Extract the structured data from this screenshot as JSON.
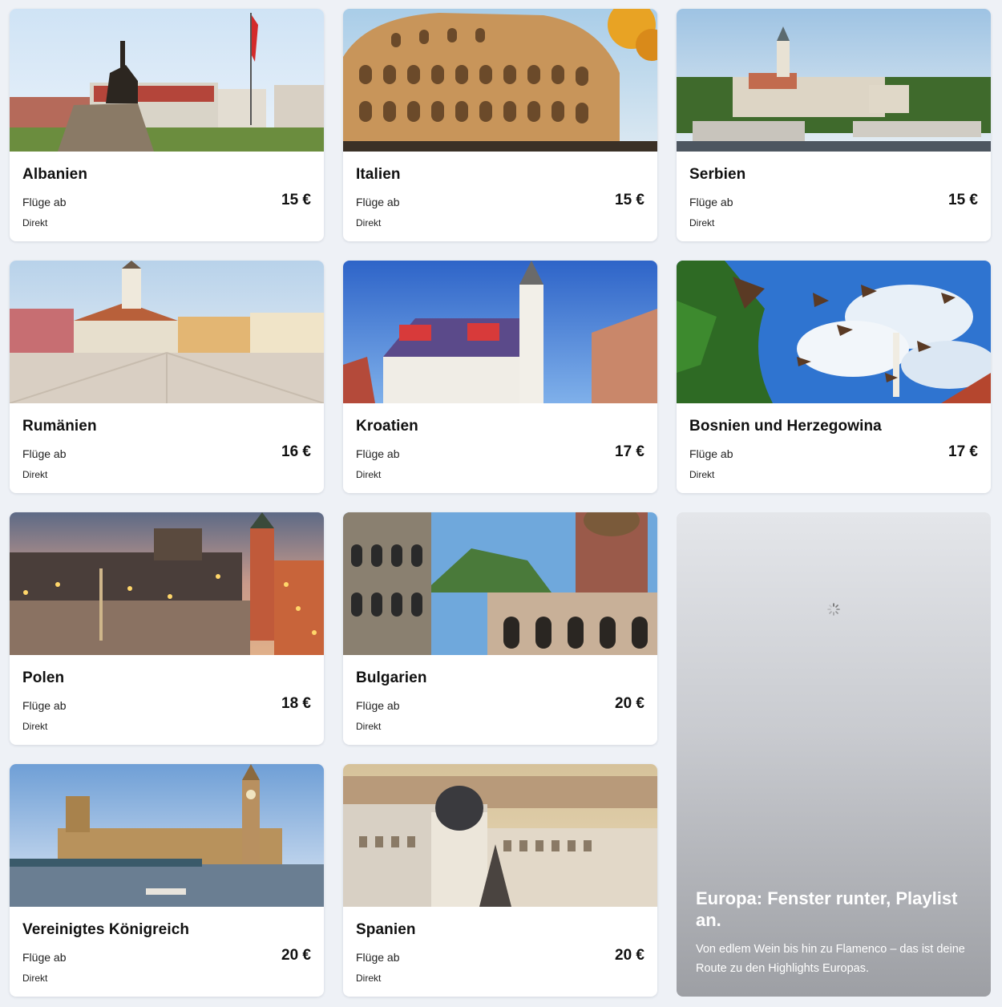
{
  "destinations": [
    {
      "name": "Albanien",
      "label": "Flüge ab",
      "price": "15 €",
      "type": "Direkt",
      "image": "albania-skanderbeg-square"
    },
    {
      "name": "Italien",
      "label": "Flüge ab",
      "price": "15 €",
      "type": "Direkt",
      "image": "rome-colosseum"
    },
    {
      "name": "Serbien",
      "label": "Flüge ab",
      "price": "15 €",
      "type": "Direkt",
      "image": "belgrade-skyline"
    },
    {
      "name": "Rumänien",
      "label": "Flüge ab",
      "price": "16 €",
      "type": "Direkt",
      "image": "brasov-council-square"
    },
    {
      "name": "Kroatien",
      "label": "Flüge ab",
      "price": "17 €",
      "type": "Direkt",
      "image": "zagreb-st-marks-church"
    },
    {
      "name": "Bosnien und Herzegowina",
      "label": "Flüge ab",
      "price": "17 €",
      "type": "Direkt",
      "image": "sarajevo-pigeons"
    },
    {
      "name": "Polen",
      "label": "Flüge ab",
      "price": "18 €",
      "type": "Direkt",
      "image": "warsaw-castle-square"
    },
    {
      "name": "Bulgarien",
      "label": "Flüge ab",
      "price": "20 €",
      "type": "Direkt",
      "image": "rila-monastery"
    },
    {
      "name": "Vereinigtes Königreich",
      "label": "Flüge ab",
      "price": "20 €",
      "type": "Direkt",
      "image": "london-westminster"
    },
    {
      "name": "Spanien",
      "label": "Flüge ab",
      "price": "20 €",
      "type": "Direkt",
      "image": "madrid-metropolis"
    }
  ],
  "promo": {
    "title": "Europa: Fenster runter, Playlist an.",
    "text": "Von edlem Wein bis hin zu Flamenco – das ist deine Route zu den Highlights Europas.",
    "icon": "loading-spinner-icon"
  },
  "colors": {
    "background": "#eef1f6",
    "card": "#ffffff",
    "text": "#111111"
  }
}
